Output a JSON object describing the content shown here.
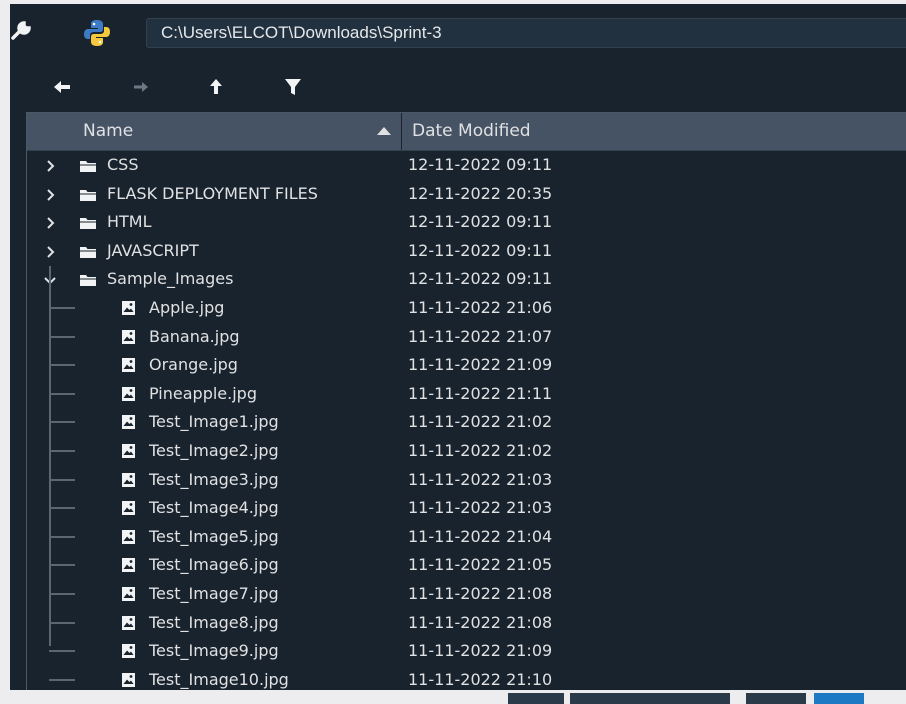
{
  "path": "C:\\Users\\ELCOT\\Downloads\\Sprint-3",
  "icons": {
    "settings": "wrench-icon",
    "app": "python-logo-icon",
    "back": "arrow-left-icon",
    "forward": "arrow-right-icon",
    "up": "arrow-up-icon",
    "filter": "filter-icon",
    "folder": "folder-icon",
    "image": "image-file-icon"
  },
  "colors": {
    "background": "#19232d",
    "header": "#455364",
    "text": "#e0e1e3",
    "accent": "#1d79c4"
  },
  "columns": {
    "name": "Name",
    "date": "Date Modified"
  },
  "folders": [
    {
      "name": "CSS",
      "date": "12-11-2022 09:11",
      "expanded": false
    },
    {
      "name": "FLASK DEPLOYMENT FILES",
      "date": "12-11-2022 20:35",
      "expanded": false
    },
    {
      "name": "HTML",
      "date": "12-11-2022 09:11",
      "expanded": false
    },
    {
      "name": "JAVASCRIPT",
      "date": "12-11-2022 09:11",
      "expanded": false
    },
    {
      "name": "Sample_Images",
      "date": "12-11-2022 09:11",
      "expanded": true
    }
  ],
  "files": [
    {
      "name": "Apple.jpg",
      "date": "11-11-2022 21:06"
    },
    {
      "name": "Banana.jpg",
      "date": "11-11-2022 21:07"
    },
    {
      "name": "Orange.jpg",
      "date": "11-11-2022 21:09"
    },
    {
      "name": "Pineapple.jpg",
      "date": "11-11-2022 21:11"
    },
    {
      "name": "Test_Image1.jpg",
      "date": "11-11-2022 21:02"
    },
    {
      "name": "Test_Image2.jpg",
      "date": "11-11-2022 21:02"
    },
    {
      "name": "Test_Image3.jpg",
      "date": "11-11-2022 21:03"
    },
    {
      "name": "Test_Image4.jpg",
      "date": "11-11-2022 21:03"
    },
    {
      "name": "Test_Image5.jpg",
      "date": "11-11-2022 21:04"
    },
    {
      "name": "Test_Image6.jpg",
      "date": "11-11-2022 21:05"
    },
    {
      "name": "Test_Image7.jpg",
      "date": "11-11-2022 21:08"
    },
    {
      "name": "Test_Image8.jpg",
      "date": "11-11-2022 21:08"
    },
    {
      "name": "Test_Image9.jpg",
      "date": "11-11-2022 21:09"
    },
    {
      "name": "Test_Image10.jpg",
      "date": "11-11-2022 21:10"
    }
  ]
}
